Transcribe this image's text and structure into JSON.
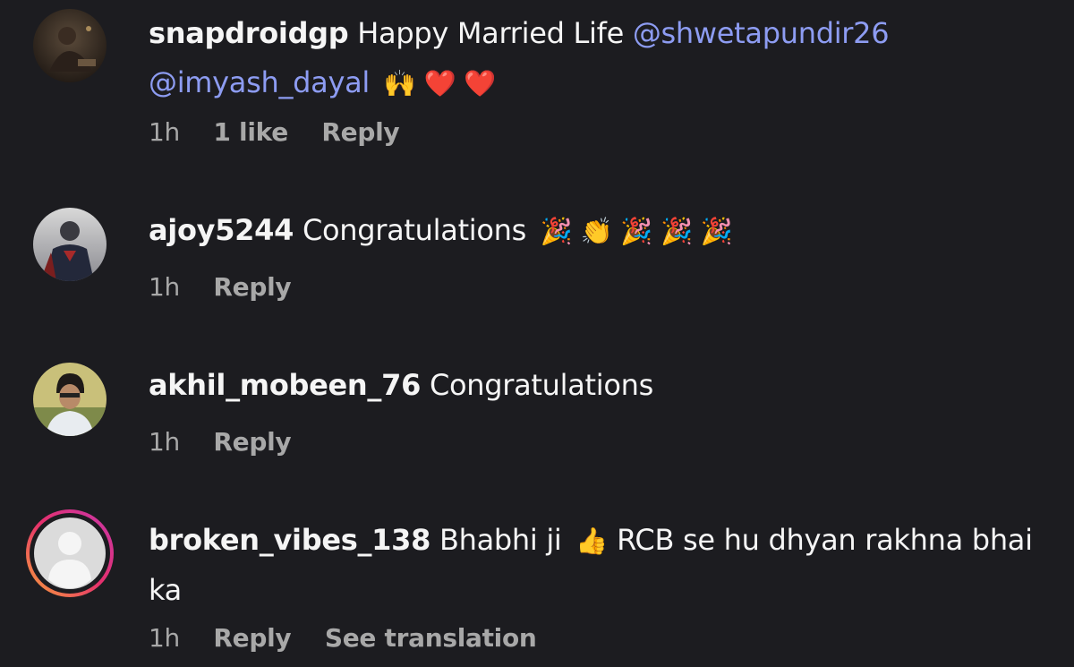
{
  "comments": [
    {
      "username": "snapdroidgp",
      "text_before": "Happy Married Life",
      "mention1": "@shwetapundir26",
      "mention2": "@imyash_dayal",
      "emojis": "🙌 ❤️ ❤️",
      "time": "1h",
      "likes": "1 like",
      "reply": "Reply"
    },
    {
      "username": "ajoy5244",
      "text": "Congratulations",
      "emojis": "🎉 👏 🎉 🎉 🎉",
      "time": "1h",
      "reply": "Reply"
    },
    {
      "username": "akhil_mobeen_76",
      "text": "Congratulations",
      "time": "1h",
      "reply": "Reply"
    },
    {
      "username": "broken_vibes_138",
      "text_before": "Bhabhi ji",
      "emoji": "👍",
      "text_after": "RCB se hu dhyan rakhna bhai ka",
      "time": "1h",
      "reply": "Reply",
      "translate": "See translation"
    }
  ],
  "colors": {
    "background": "#1c1c20",
    "text": "#f5f5f5",
    "muted": "#a8a8a8",
    "mention": "#8d9cf2",
    "story_ring_start": "#f9a43a",
    "story_ring_end": "#c837ab"
  }
}
